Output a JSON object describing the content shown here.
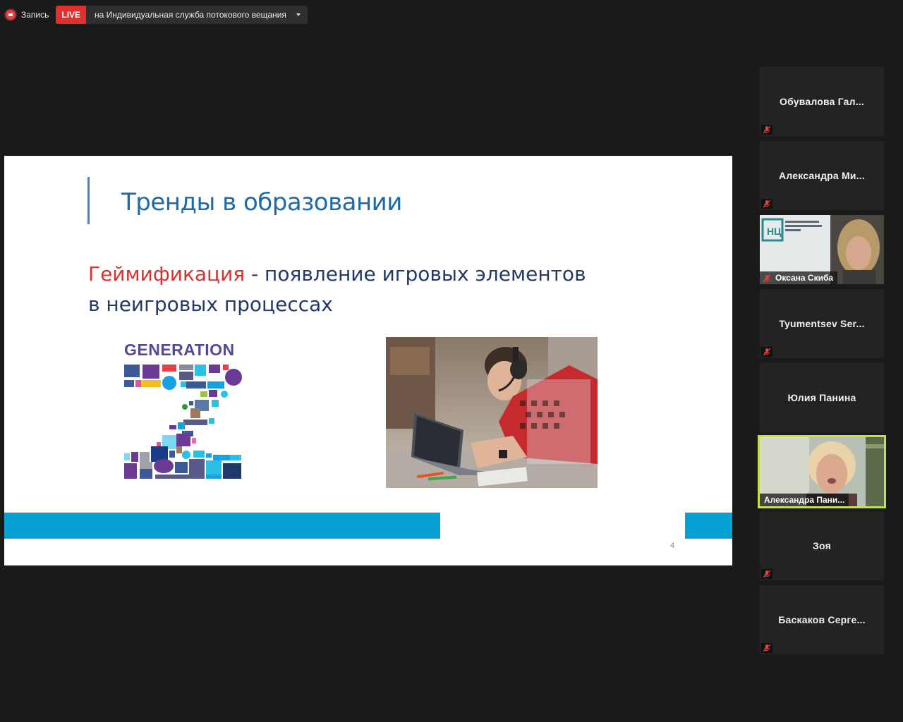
{
  "status_bar": {
    "record_label": "Запись",
    "live_badge": "LIVE",
    "live_service": "на Индивидуальная служба потокового вещания"
  },
  "slide": {
    "title": "Тренды в образовании",
    "accent_word": "Геймификация",
    "line1_rest": " - появление игровых элементов",
    "line2": "в неигровых процессах",
    "genz_title": "GENERATION",
    "page_number": "4",
    "colors": {
      "title": "#1c6aa8",
      "accent": "#d8312f",
      "stripe": "#06a0d2",
      "body": "#233a66"
    }
  },
  "participants": [
    {
      "name": "Обувалова  Гал...",
      "muted": true,
      "video": false
    },
    {
      "name": "Александра  Ми...",
      "muted": true,
      "video": false
    },
    {
      "name": "Оксана Скиба",
      "muted": true,
      "video": true
    },
    {
      "name": "Tyumentsev  Ser...",
      "muted": true,
      "video": false
    },
    {
      "name": "Юлия Панина",
      "muted": false,
      "video": false
    },
    {
      "name": "Александра Пани...",
      "muted": false,
      "video": true,
      "speaking": true
    },
    {
      "name": "Зоя",
      "muted": true,
      "video": false
    },
    {
      "name": "Баскаков  Серге...",
      "muted": true,
      "video": false
    }
  ],
  "icons": {
    "record": "record-icon",
    "mic_muted": "mic-muted-icon",
    "dropdown": "chevron-down-icon"
  }
}
